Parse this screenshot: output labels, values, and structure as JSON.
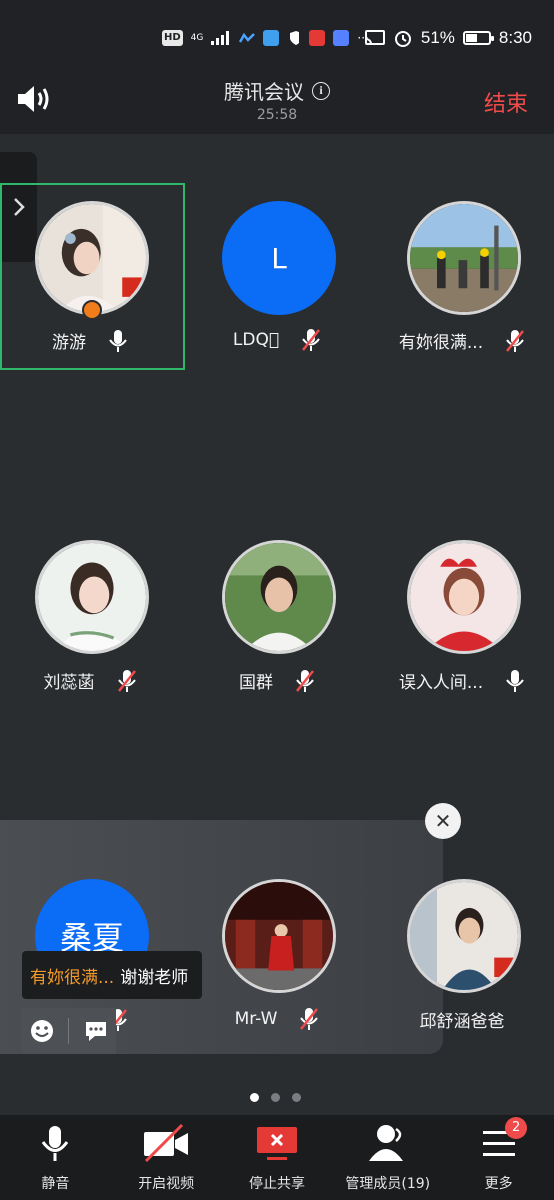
{
  "status_bar": {
    "network_hd": "HD",
    "network_gen": "4G",
    "more": "···",
    "battery_percent": "51%",
    "battery_level": 0.51,
    "time": "8:30"
  },
  "header": {
    "title": "腾讯会议",
    "timer": "25:58",
    "end_label": "结束"
  },
  "participants": [
    {
      "name": "游游",
      "mic": "on",
      "avatar": "photo",
      "host": true,
      "active": true
    },
    {
      "name": "LDQ\u0000",
      "mic": "muted",
      "avatar": "letter",
      "letter": "L"
    },
    {
      "name": "有妳很满...",
      "mic": "muted",
      "avatar": "photo"
    },
    {
      "name": "刘蕊菡",
      "mic": "muted",
      "avatar": "photo"
    },
    {
      "name": "国群",
      "mic": "muted",
      "avatar": "photo"
    },
    {
      "name": "误入人间...",
      "mic": "on",
      "avatar": "photo"
    },
    {
      "name": "桑夏",
      "mic": "muted",
      "avatar": "letter",
      "letter": "桑夏"
    },
    {
      "name": "Mr-W",
      "mic": "muted",
      "avatar": "photo"
    },
    {
      "name": "邱舒涵爸爸",
      "mic": "none",
      "avatar": "photo"
    }
  ],
  "chat": {
    "sender": "有妳很满...",
    "message": "谢谢老师"
  },
  "pagination": {
    "pages": 3,
    "current": 1
  },
  "toolbar": {
    "mute_label": "静音",
    "video_label": "开启视频",
    "share_label": "停止共享",
    "members_label": "管理成员(19)",
    "more_label": "更多",
    "more_badge": "2"
  }
}
